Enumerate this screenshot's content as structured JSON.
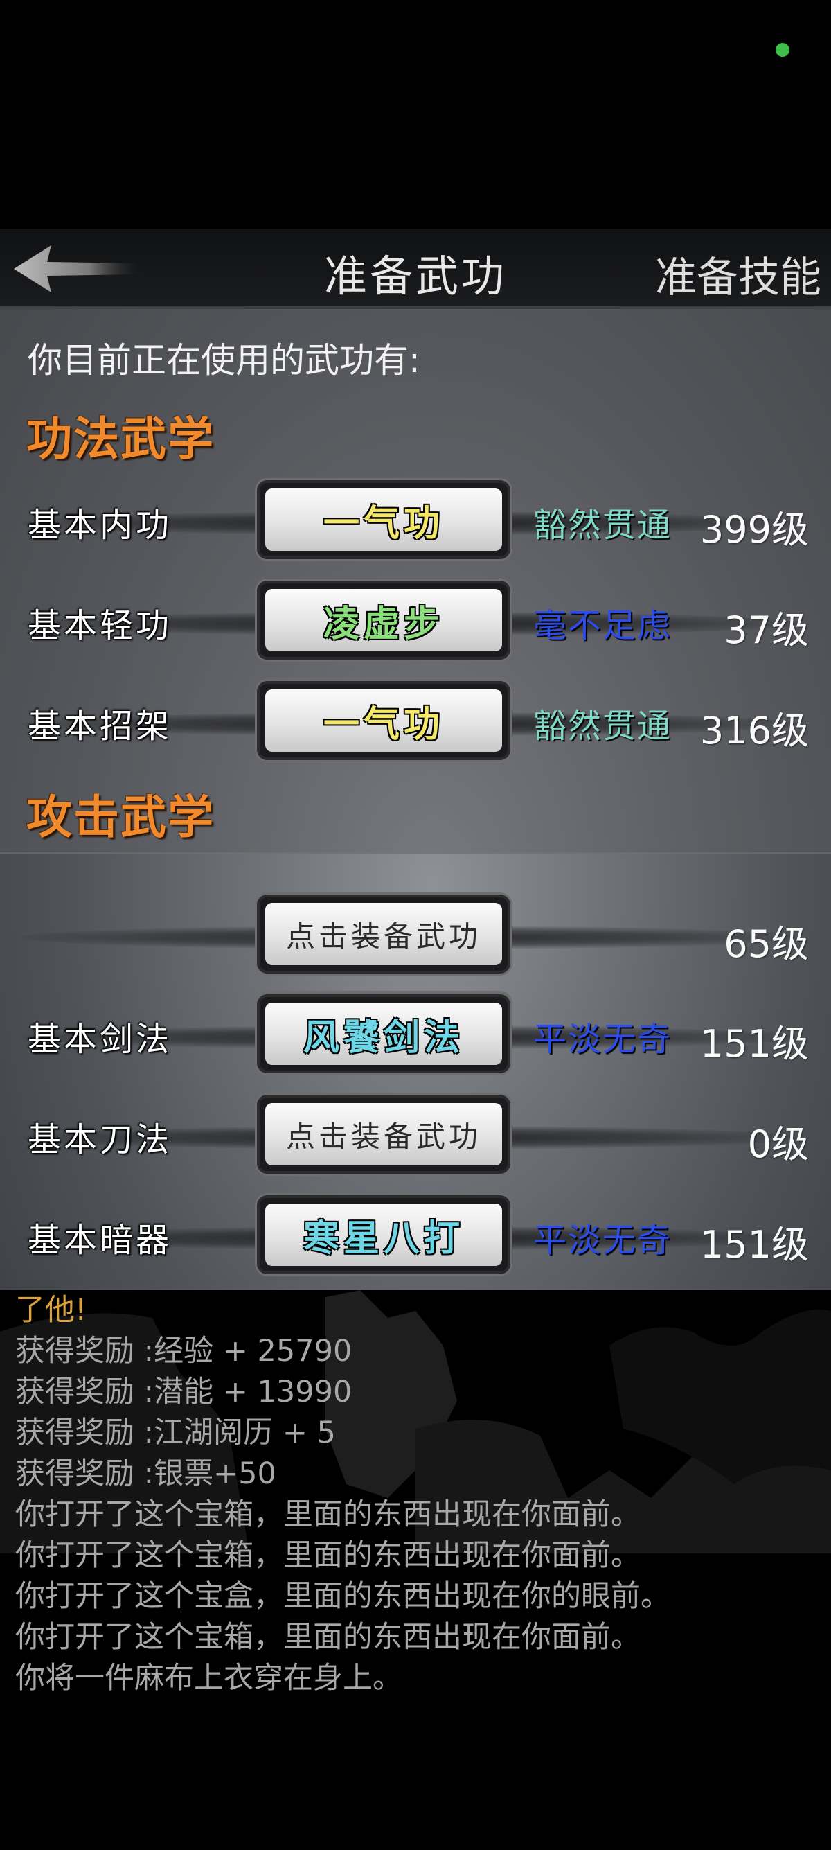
{
  "header": {
    "title": "准备武功",
    "right_label": "准备技能"
  },
  "intro": "你目前正在使用的武功有:",
  "sections": {
    "internal": "功法武学",
    "attack": "攻击武学"
  },
  "rows": [
    {
      "label": "基本内功",
      "skill": "一气功",
      "rank": "豁然贯通",
      "level": "399级"
    },
    {
      "label": "基本轻功",
      "skill": "凌虚步",
      "rank": "毫不足虑",
      "level": "37级"
    },
    {
      "label": "基本招架",
      "skill": "一气功",
      "rank": "豁然贯通",
      "level": "316级"
    },
    {
      "label": "",
      "skill": "点击装备武功",
      "rank": "",
      "level": "65级"
    },
    {
      "label": "基本剑法",
      "skill": "风饕剑法",
      "rank": "平淡无奇",
      "level": "151级"
    },
    {
      "label": "基本刀法",
      "skill": "点击装备武功",
      "rank": "",
      "level": "0级"
    },
    {
      "label": "基本暗器",
      "skill": "寒星八打",
      "rank": "平淡无奇",
      "level": "151级"
    }
  ],
  "log": [
    "了他!",
    "获得奖励 :经验 + 25790",
    "获得奖励 :潜能 + 13990",
    "获得奖励 :江湖阅历 + 5",
    "获得奖励 :银票+50",
    "你打开了这个宝箱，里面的东西出现在你面前。",
    "你打开了这个宝箱，里面的东西出现在你面前。",
    "你打开了这个宝盒，里面的东西出现在你的眼前。",
    "你打开了这个宝箱，里面的东西出现在你面前。",
    "你将一件麻布上衣穿在身上。"
  ],
  "colors": {
    "section_title": "#f08a2c",
    "rank_teal": "#7fd8c8",
    "rank_blue": "#2c4de8",
    "status_dot": "#3fbf4a"
  }
}
